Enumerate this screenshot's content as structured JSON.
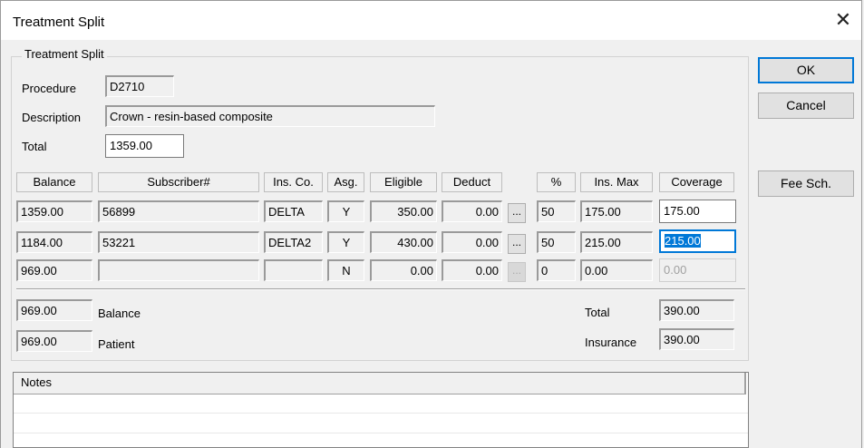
{
  "window": {
    "title": "Treatment Split"
  },
  "group_title": "Treatment Split",
  "procedure": {
    "label": "Procedure",
    "value": "D2710"
  },
  "description": {
    "label": "Description",
    "value": "Crown - resin-based composite"
  },
  "total": {
    "label": "Total",
    "value": "1359.00"
  },
  "columns": {
    "balance": "Balance",
    "subscriber": "Subscriber#",
    "insco": "Ins. Co.",
    "asg": "Asg.",
    "eligible": "Eligible",
    "deduct": "Deduct",
    "pct": "%",
    "insmax": "Ins. Max",
    "coverage": "Coverage"
  },
  "rows": [
    {
      "balance": "1359.00",
      "subscriber": "56899",
      "insco": "DELTA",
      "asg": "Y",
      "eligible": "350.00",
      "deduct": "0.00",
      "dots": "...",
      "pct": "50",
      "insmax": "175.00",
      "coverage": "175.00"
    },
    {
      "balance": "1184.00",
      "subscriber": "53221",
      "insco": "DELTA2",
      "asg": "Y",
      "eligible": "430.00",
      "deduct": "0.00",
      "dots": "...",
      "pct": "50",
      "insmax": "215.00",
      "coverage": "215.00"
    },
    {
      "balance": "969.00",
      "subscriber": "",
      "insco": "",
      "asg": "N",
      "eligible": "0.00",
      "deduct": "0.00",
      "dots": "...",
      "pct": "0",
      "insmax": "0.00",
      "coverage": "0.00"
    }
  ],
  "summary": {
    "balance_value": "969.00",
    "balance_label": "Balance",
    "patient_value": "969.00",
    "patient_label": "Patient",
    "total_label": "Total",
    "total_value": "390.00",
    "insurance_label": "Insurance",
    "insurance_value": "390.00"
  },
  "buttons": {
    "ok": "OK",
    "cancel": "Cancel",
    "fee_sch": "Fee Sch."
  },
  "notes": {
    "header": "Notes"
  },
  "icons": {
    "close": "close-icon"
  }
}
